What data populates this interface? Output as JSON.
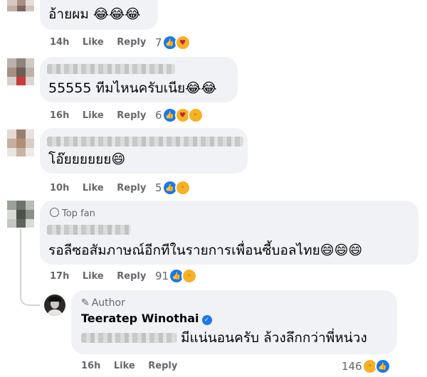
{
  "comments": [
    {
      "text": "อ้ายผม 😂😂😂",
      "time": "14h",
      "like": "Like",
      "reply": "Reply",
      "reaction_count": "7",
      "reactions": [
        "like-icon",
        "care-icon"
      ]
    },
    {
      "text": "55555 ทีมไหนครับเนีย😂😂",
      "time": "16h",
      "like": "Like",
      "reply": "Reply",
      "reaction_count": "6",
      "reactions": [
        "like-icon",
        "care-icon",
        "haha-icon"
      ]
    },
    {
      "text": "โอ๊ยยยยยย😄",
      "time": "10h",
      "like": "Like",
      "reply": "Reply",
      "reaction_count": "5",
      "reactions": [
        "like-icon",
        "haha-icon"
      ]
    },
    {
      "badge": "Top fan",
      "text": "รอลีซอสัมภาษณ์อีกทีในรายการเพื่อนซี้บอลไทย😄😄😄",
      "time": "17h",
      "like": "Like",
      "reply": "Reply",
      "reaction_count": "91",
      "reactions": [
        "like-icon",
        "haha-icon"
      ]
    }
  ],
  "reply": {
    "badge": "Author",
    "author_name": "Teeratep Winothai",
    "text": "มีแน่นอนครับ ล้วงลึกกว่าพี่หน่วง",
    "time": "16h",
    "like": "Like",
    "reply": "Reply",
    "reaction_count": "146",
    "reactions": [
      "haha-icon",
      "like-icon"
    ]
  },
  "colors": {
    "like": "#1877f2",
    "haha": "#f7b125",
    "bubble": "#f0f2f5",
    "meta": "#65676b"
  }
}
